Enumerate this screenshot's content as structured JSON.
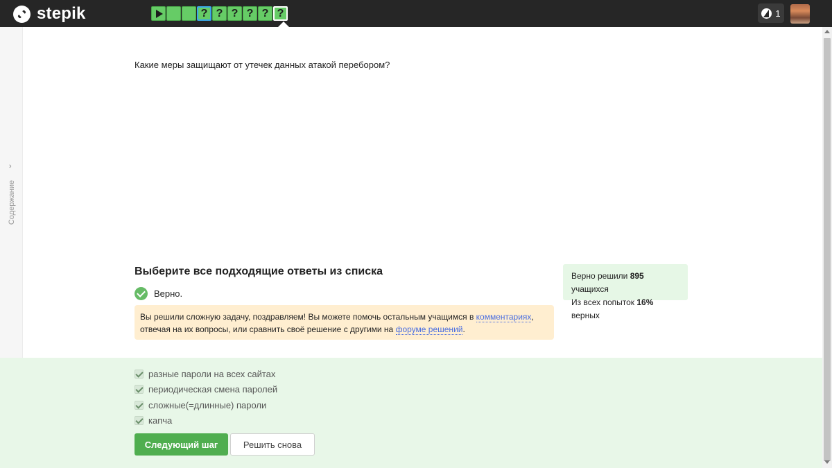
{
  "header": {
    "logo_text": "stepik",
    "steps": [
      {
        "type": "play",
        "label": ""
      },
      {
        "type": "done",
        "label": ""
      },
      {
        "type": "done",
        "label": ""
      },
      {
        "type": "question",
        "label": "?"
      },
      {
        "type": "question",
        "label": "?"
      },
      {
        "type": "question",
        "label": "?"
      },
      {
        "type": "question",
        "label": "?"
      },
      {
        "type": "question",
        "label": "?"
      },
      {
        "type": "question",
        "label": "?"
      }
    ],
    "energy_count": "1"
  },
  "sidebar": {
    "label": "Содержание"
  },
  "content": {
    "question": "Какие меры защищают от утечек данных атакой перебором?",
    "quiz_title": "Выберите все подходящие ответы из списка",
    "status": "Верно.",
    "congrats": {
      "part1": "Вы решили сложную задачу, поздравляем! Вы можете помочь остальным учащимся в ",
      "link1": "комментариях",
      "part2": ", отвечая на их вопросы, или сравнить своё решение с другими на ",
      "link2": "форуме решений",
      "part3": "."
    },
    "stats": {
      "line1_prefix": "Верно решили ",
      "line1_count": "895",
      "line1_suffix": " учащихся",
      "line2_prefix": "Из всех попыток ",
      "line2_percent": "16%",
      "line2_suffix": " верных"
    }
  },
  "answers": {
    "options": [
      {
        "label": "разные пароли на всех сайтах",
        "checked": true
      },
      {
        "label": "периодическая смена паролей",
        "checked": true
      },
      {
        "label": "сложные(=длинные) пароли",
        "checked": true
      },
      {
        "label": "капча",
        "checked": true
      }
    ],
    "next_button": "Следующий шаг",
    "retry_button": "Решить снова"
  }
}
